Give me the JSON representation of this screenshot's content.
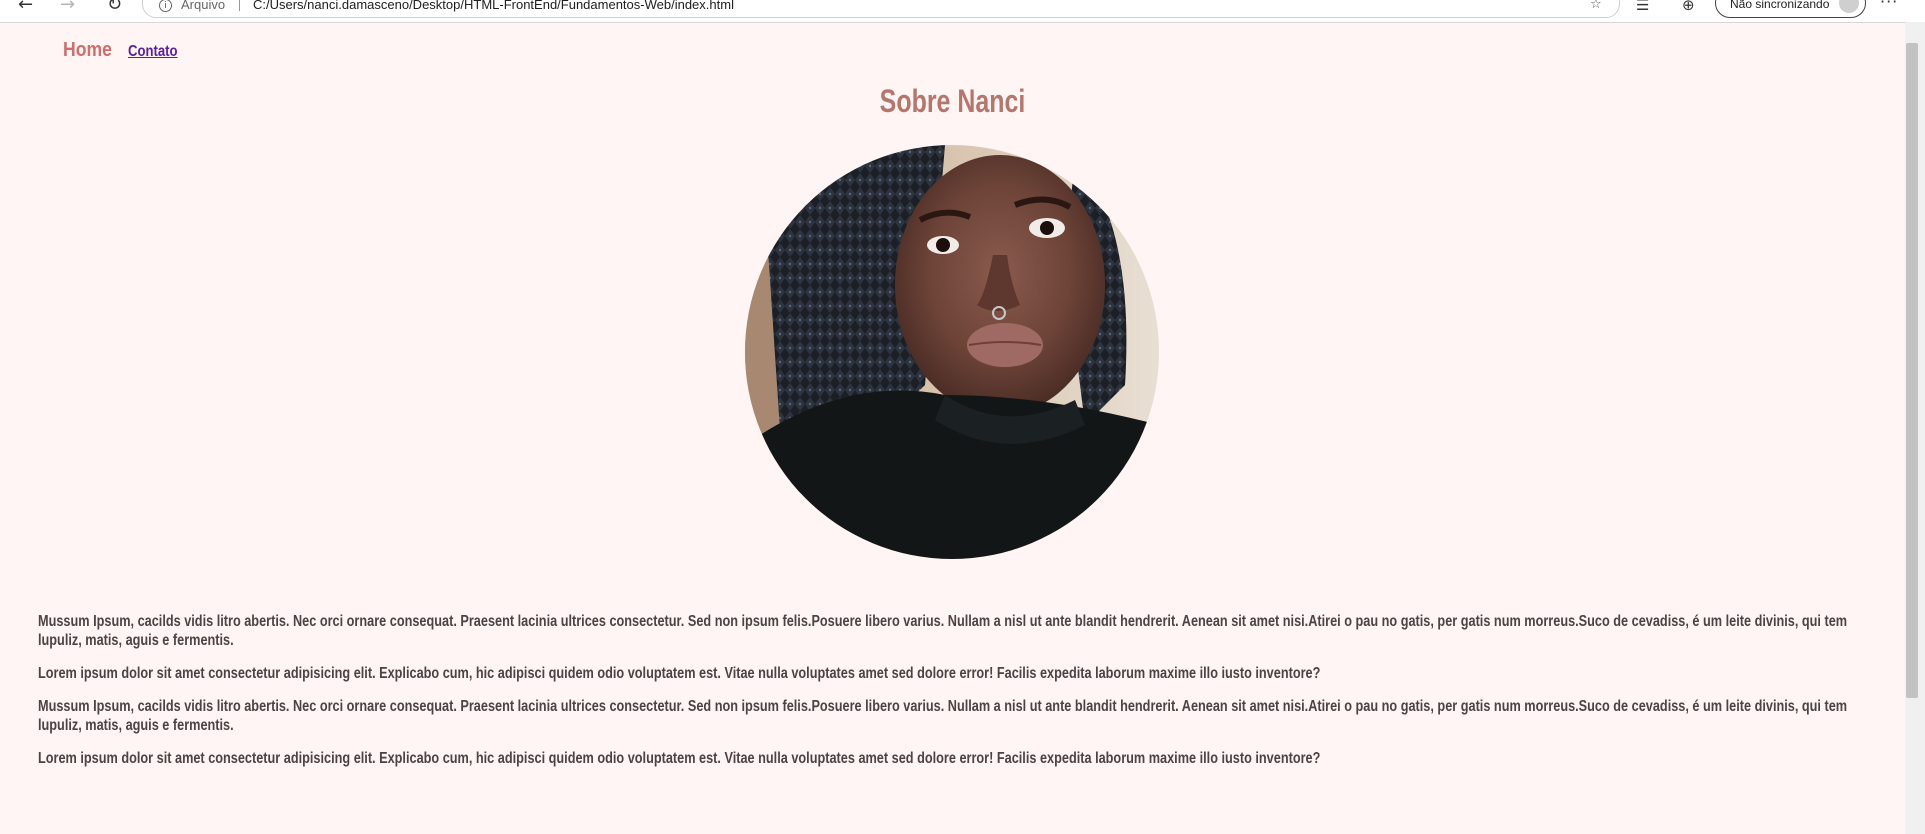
{
  "browser": {
    "back_icon": "arrow-left-icon",
    "forward_icon": "arrow-right-icon",
    "refresh_icon": "refresh-icon",
    "protocol_label": "Arquivo",
    "url": "C:/Users/nanci.damasceno/Desktop/HTML-FrontEnd/Fundamentos-Web/index.html",
    "sync_label": "Não sincronizando",
    "more_icon": "more-icon"
  },
  "nav": {
    "home_label": "Home",
    "contato_label": "Contato"
  },
  "main": {
    "title": "Sobre Nanci",
    "paragraphs": [
      "Mussum Ipsum, cacilds vidis litro abertis. Nec orci ornare consequat. Praesent lacinia ultrices consectetur. Sed non ipsum felis.Posuere libero varius. Nullam a nisl ut ante blandit hendrerit. Aenean sit amet nisi.Atirei o pau no gatis, per gatis num morreus.Suco de cevadiss, é um leite divinis, qui tem lupuliz, matis, aguis e fermentis.",
      "Lorem ipsum dolor sit amet consectetur adipisicing elit. Explicabo cum, hic adipisci quidem odio voluptatem est. Vitae nulla voluptates amet sed dolore error! Facilis expedita laborum maxime illo iusto inventore?",
      "Mussum Ipsum, cacilds vidis litro abertis. Nec orci ornare consequat. Praesent lacinia ultrices consectetur. Sed non ipsum felis.Posuere libero varius. Nullam a nisl ut ante blandit hendrerit. Aenean sit amet nisi.Atirei o pau no gatis, per gatis num morreus.Suco de cevadiss, é um leite divinis, qui tem lupuliz, matis, aguis e fermentis.",
      "Lorem ipsum dolor sit amet consectetur adipisicing elit. Explicabo cum, hic adipisci quidem odio voluptatem est. Vitae nulla voluptates amet sed dolore error! Facilis expedita laborum maxime illo iusto inventore?"
    ]
  },
  "colors": {
    "background": "#fff5f4",
    "title": "#b5766c",
    "home_link": "#d06d6d",
    "contato_link": "#5a1ea2",
    "body_text": "#4a4444"
  }
}
